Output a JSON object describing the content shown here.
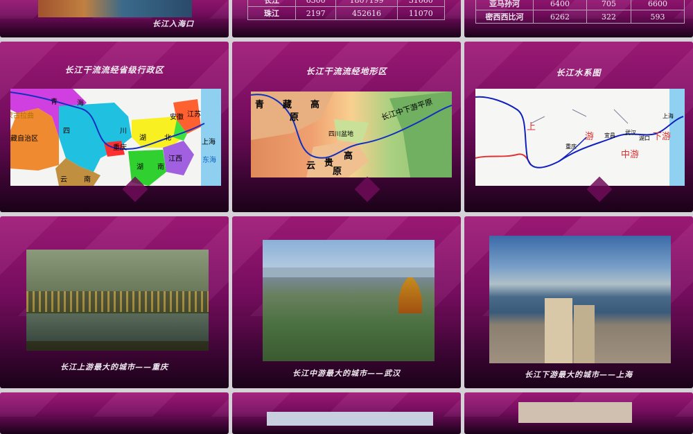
{
  "slides": {
    "s1": {
      "caption": "长江入海口"
    },
    "s2": {
      "rows": [
        {
          "name": "长江",
          "a": "6300",
          "b": "1807199",
          "c": "31060"
        },
        {
          "name": "珠江",
          "a": "2197",
          "b": "452616",
          "c": "11070"
        }
      ]
    },
    "s3": {
      "rows": [
        {
          "name": "亚马孙河",
          "a": "6400",
          "b": "705",
          "c": "6600"
        },
        {
          "name": "密西西比河",
          "a": "6262",
          "b": "322",
          "c": "593"
        }
      ]
    },
    "s4": {
      "title": "长江干流流经省级行政区",
      "labels": {
        "qinghai_a": "青",
        "qinghai_b": "海",
        "tibet": "藏自治区",
        "inner": "蒙古拉曲",
        "sichuan_a": "四",
        "sichuan_b": "川",
        "chongqing": "重庆",
        "hubei_a": "湖",
        "hubei_b": "北",
        "hunan_a": "湖",
        "hunan_b": "南",
        "yunnan_a": "云",
        "yunnan_b": "南",
        "anhui": "安徽",
        "jiangsu": "江苏",
        "jiangxi": "江西",
        "shanghai": "上海",
        "donghai": "东海"
      }
    },
    "s5": {
      "title": "长江干流流经地形区",
      "labels": {
        "qz_a": "青",
        "qz_b": "藏",
        "qz_c": "高",
        "qz_d": "原",
        "yg_a": "云",
        "yg_b": "贵",
        "yg_c": "高",
        "yg_d": "原",
        "basin": "四川盆地",
        "plain": "长江中下游平原"
      }
    },
    "s6": {
      "title": "长江水系图",
      "labels": {
        "upper": "上",
        "mid_a": "游",
        "middle": "中游",
        "lower": "下游",
        "yichang": "宜昌",
        "wuhan": "武汉",
        "chongqing": "重庆",
        "hukou": "湖口",
        "shanghai": "上海"
      }
    },
    "s7": {
      "caption": "长江上游最大的城市——重庆"
    },
    "s8": {
      "caption": "长江中游最大的城市——武汉"
    },
    "s9": {
      "caption": "长江下游最大的城市——上海"
    }
  }
}
